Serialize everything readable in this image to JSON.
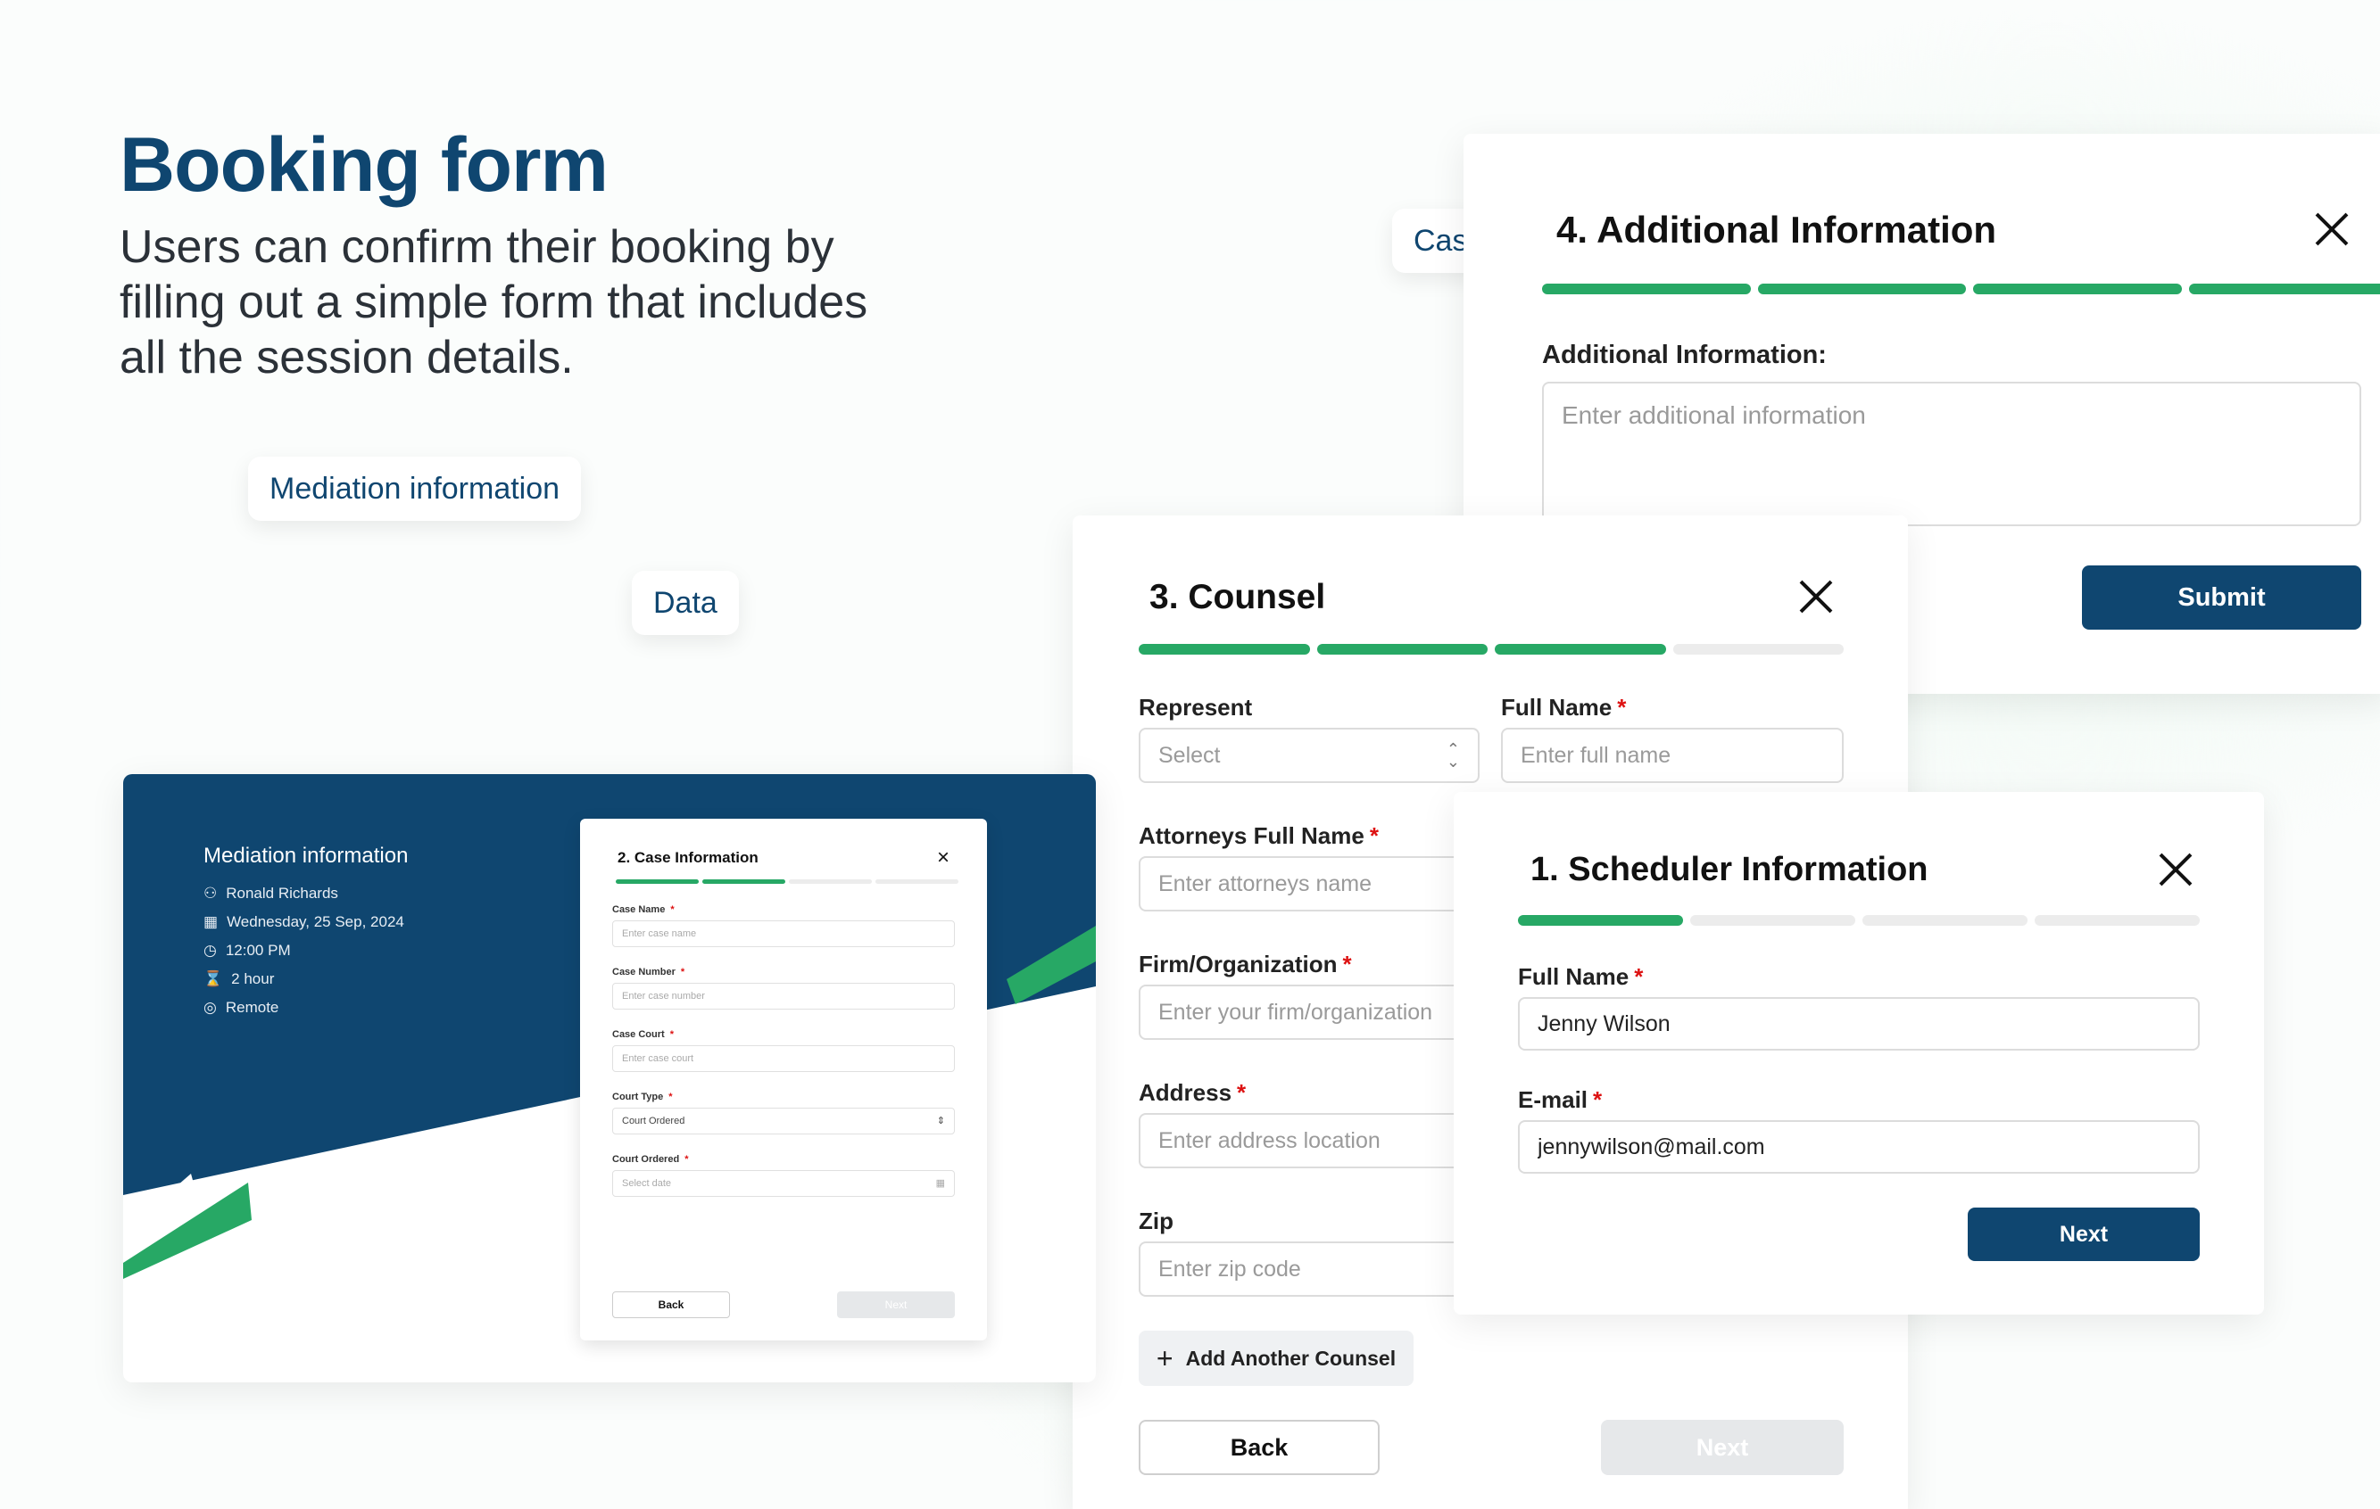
{
  "hero": {
    "title": "Booking form",
    "subtitle": "Users can confirm their booking by filling out a simple form that includes all the session details."
  },
  "pills": {
    "case": "Case",
    "mediation": "Mediation information",
    "data": "Data"
  },
  "additional": {
    "title": "4. Additional Information",
    "progress": [
      true,
      true,
      true,
      true
    ],
    "label": "Additional Information:",
    "placeholder": "Enter additional information",
    "submit": "Submit"
  },
  "counsel": {
    "title": "3. Counsel",
    "progress": [
      true,
      true,
      true,
      false
    ],
    "represent_label": "Represent",
    "represent_value": "Select",
    "fullname_label": "Full Name",
    "fullname_placeholder": "Enter full name",
    "attorney_label": "Attorneys Full Name",
    "attorney_placeholder": "Enter attorneys name",
    "firm_label": "Firm/Organization",
    "firm_placeholder": "Enter your firm/organization",
    "address_label": "Address",
    "address_placeholder": "Enter address location",
    "zip_label": "Zip",
    "zip_placeholder": "Enter zip code",
    "add_counsel": "Add Another Counsel",
    "back": "Back",
    "next": "Next",
    "required_mark": "*"
  },
  "scheduler": {
    "title": "1. Scheduler Information",
    "progress": [
      true,
      false,
      false,
      false
    ],
    "fullname_label": "Full Name",
    "fullname_value": "Jenny Wilson",
    "email_label": "E-mail",
    "email_value": "jennywilson@mail.com",
    "next": "Next"
  },
  "mock": {
    "title": "Mediation information",
    "details": [
      {
        "icon": "user-icon",
        "text": "Ronald Richards"
      },
      {
        "icon": "calendar-icon",
        "text": "Wednesday,  25 Sep, 2024"
      },
      {
        "icon": "clock-icon",
        "text": "12:00 PM"
      },
      {
        "icon": "hourglass-icon",
        "text": "2 hour"
      },
      {
        "icon": "location-icon",
        "text": "Remote"
      }
    ],
    "form": {
      "title": "2. Case Information",
      "progress": [
        true,
        true,
        false,
        false
      ],
      "case_name_label": "Case Name",
      "case_name_placeholder": "Enter case name",
      "case_number_label": "Case Number",
      "case_number_placeholder": "Enter case  number",
      "case_court_label": "Case Court",
      "case_court_placeholder": "Enter case court",
      "court_type_label": "Court Type",
      "court_type_value": "Court Ordered",
      "court_ordered_label": "Court Ordered",
      "court_ordered_placeholder": "Select date",
      "back": "Back",
      "next": "Next"
    }
  },
  "colors": {
    "brand": "#0f4670",
    "accent": "#27a865"
  }
}
